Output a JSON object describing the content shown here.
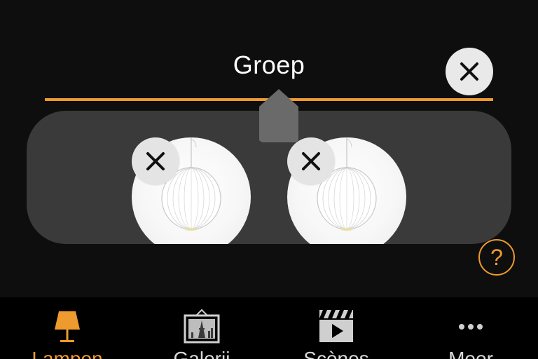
{
  "group": {
    "title": "Groep"
  },
  "lamps": [
    {
      "name": "lamp-1"
    },
    {
      "name": "lamp-2"
    }
  ],
  "help": {
    "label": "?"
  },
  "colors": {
    "accent": "#ee9a2f",
    "background": "#0e0e0e",
    "panel": "#3a3a3a",
    "tabbar": "#000000"
  },
  "tabs": [
    {
      "label": "Lampen",
      "icon": "lamp-icon",
      "active": true
    },
    {
      "label": "Galerij",
      "icon": "gallery-icon",
      "active": false
    },
    {
      "label": "Scènes",
      "icon": "scenes-icon",
      "active": false
    },
    {
      "label": "Meer",
      "icon": "more-icon",
      "active": false
    }
  ]
}
